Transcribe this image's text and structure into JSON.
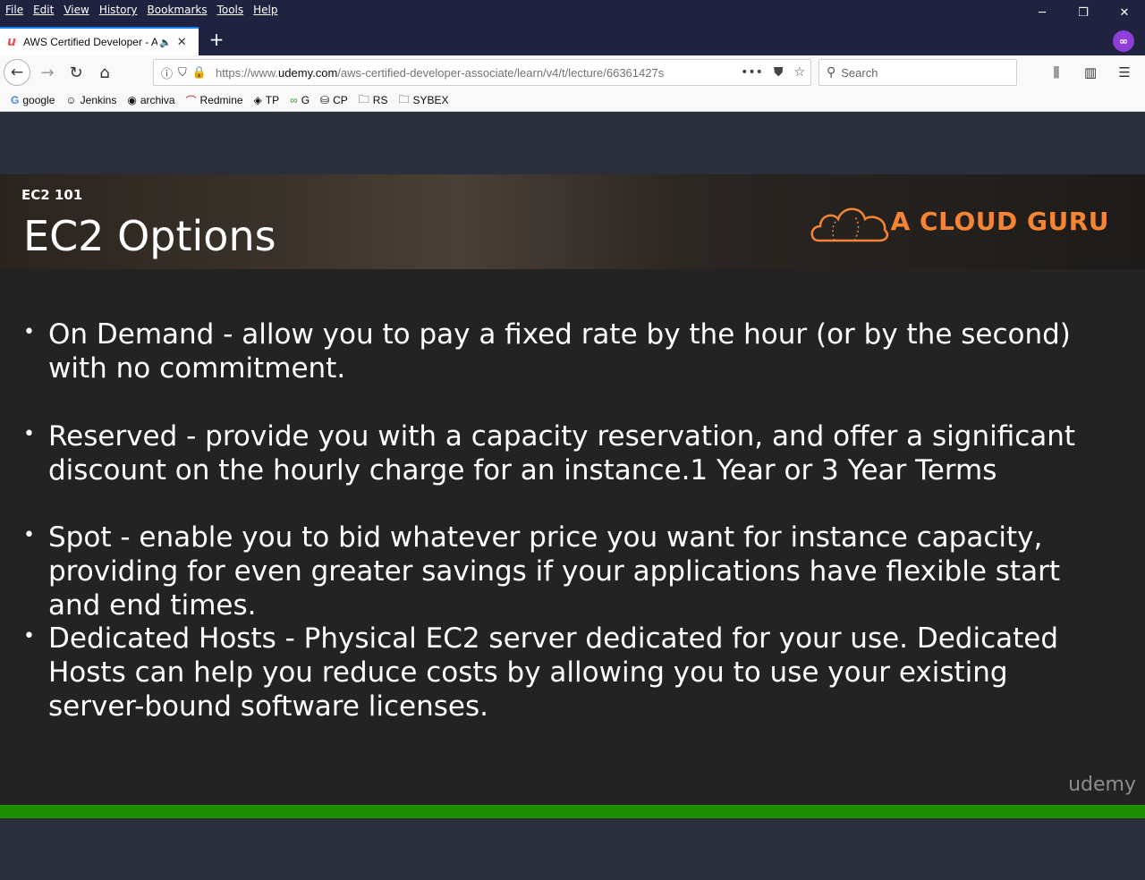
{
  "menu": [
    "File",
    "Edit",
    "View",
    "History",
    "Bookmarks",
    "Tools",
    "Help"
  ],
  "window_controls": {
    "minimize": "─",
    "restore": "❐",
    "close": "✕"
  },
  "tab": {
    "title": "AWS Certified Developer - A",
    "favicon": "u"
  },
  "private_badge": "∞",
  "address": {
    "url_prefix": "https://www.",
    "url_domain": "udemy.com",
    "url_rest": "/aws-certified-developer-associate/learn/v4/t/lecture/66361427s",
    "more": "•••"
  },
  "search": {
    "placeholder": "Search"
  },
  "bookmarks": [
    {
      "label": "google",
      "icon": "G"
    },
    {
      "label": "Jenkins",
      "icon": "☺"
    },
    {
      "label": "archiva",
      "icon": "◉"
    },
    {
      "label": "Redmine",
      "icon": "⌒"
    },
    {
      "label": "TP",
      "icon": "◈"
    },
    {
      "label": "G",
      "icon": "∞"
    },
    {
      "label": "CP",
      "icon": "⛁"
    },
    {
      "label": "RS",
      "icon": "🗀"
    },
    {
      "label": "SYBEX",
      "icon": "🗀"
    }
  ],
  "slide": {
    "section": "EC2 101",
    "title": "EC2 Options",
    "brand": "A CLOUD GURU",
    "bullets": [
      "On Demand - allow you to pay a fixed rate by the hour (or by the second) with no commitment.",
      "Reserved - provide you with a capacity reservation, and offer a significant discount on the hourly charge for an instance.1 Year or 3 Year Terms",
      "Spot - enable you to bid whatever price you want for instance capacity, providing for even greater savings if your applications have flexible start and end times.",
      "Dedicated Hosts - Physical EC2 server dedicated for your use. Dedicated Hosts can help you reduce costs by allowing you to use your existing server-bound software licenses."
    ],
    "watermark": "udemy"
  },
  "colors": {
    "accent": "#f58535",
    "progress": "#1e8f00",
    "chrome": "#202340"
  },
  "progress_fraction": 1.0
}
